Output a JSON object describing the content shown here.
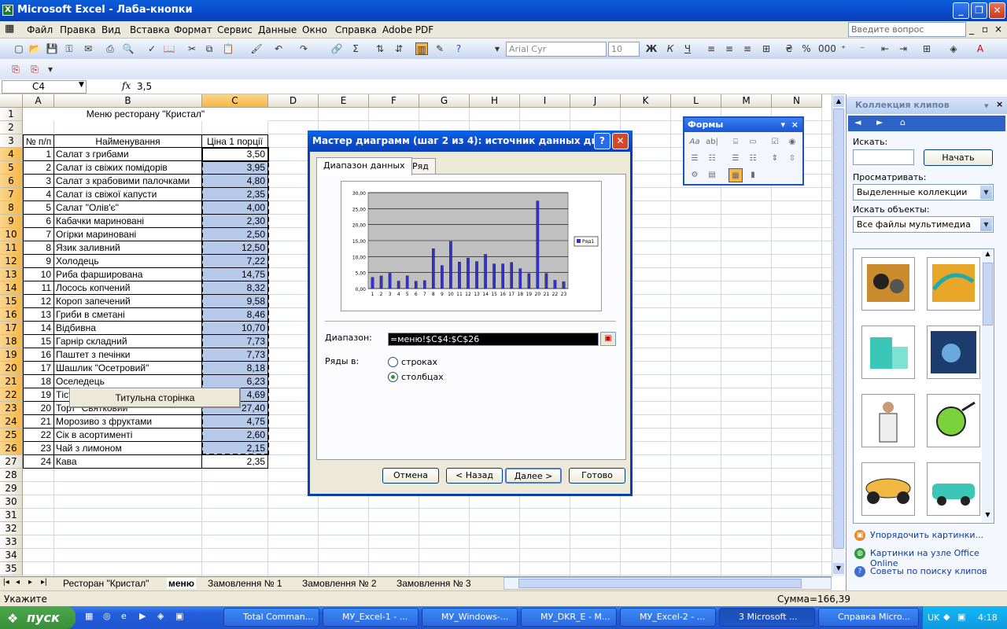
{
  "app": {
    "title": "Microsoft Excel - Лаба-кнопки",
    "logo_glyph": "X"
  },
  "menu": [
    {
      "label": "Файл"
    },
    {
      "label": "Правка"
    },
    {
      "label": "Вид"
    },
    {
      "label": "Вставка"
    },
    {
      "label": "Формат"
    },
    {
      "label": "Сервис"
    },
    {
      "label": "Данные"
    },
    {
      "label": "Окно"
    },
    {
      "label": "Справка"
    },
    {
      "label": "Adobe PDF"
    }
  ],
  "ask": {
    "placeholder": "Введите вопрос"
  },
  "font": {
    "name": "Arial Cyr",
    "size": "10"
  },
  "formula": {
    "cell": "C4",
    "fx": "fx",
    "value": "3,5"
  },
  "columns": [
    "A",
    "B",
    "C",
    "D",
    "E",
    "F",
    "G",
    "H",
    "I",
    "J",
    "K",
    "L",
    "M",
    "N"
  ],
  "rows": [
    "1",
    "2",
    "3",
    "4",
    "5",
    "6",
    "7",
    "8",
    "9",
    "10",
    "11",
    "12",
    "13",
    "14",
    "15",
    "16",
    "17",
    "18",
    "19",
    "20",
    "21",
    "22",
    "23",
    "24",
    "25",
    "26",
    "27",
    "28",
    "29",
    "30",
    "31",
    "32",
    "33",
    "34",
    "35"
  ],
  "sheet": {
    "title": "Меню ресторану \"Кристал\"",
    "headers": [
      "№ п/п",
      "Найменування",
      "Ціна 1 порції"
    ],
    "items": [
      [
        "1",
        "Салат з грибами",
        "3,50"
      ],
      [
        "2",
        "Салат із свіжих помідорів",
        "3,95"
      ],
      [
        "3",
        "Салат з крабовими палочками",
        "4,80"
      ],
      [
        "4",
        "Салат із свіжої капусти",
        "2,35"
      ],
      [
        "5",
        "Салат \"Олів'є\"",
        "4,00"
      ],
      [
        "6",
        "Кабачки мариновані",
        "2,30"
      ],
      [
        "7",
        "Огірки мариновані",
        "2,50"
      ],
      [
        "8",
        "Язик заливний",
        "12,50"
      ],
      [
        "9",
        "Холодець",
        "7,22"
      ],
      [
        "10",
        "Риба фарширована",
        "14,75"
      ],
      [
        "11",
        "Лосось копчений",
        "8,32"
      ],
      [
        "12",
        "Короп запечений",
        "9,58"
      ],
      [
        "13",
        "Гриби в сметані",
        "8,46"
      ],
      [
        "14",
        "Відбивна",
        "10,70"
      ],
      [
        "15",
        "Гарнір складний",
        "7,73"
      ],
      [
        "16",
        "Паштет з печінки",
        "7,73"
      ],
      [
        "17",
        "Шашлик \"Осетровий\"",
        "8,18"
      ],
      [
        "18",
        "Оселедець",
        "6,23"
      ],
      [
        "19",
        "Тістечко \"Наполіон\"",
        "4,69"
      ],
      [
        "20",
        "Торт \"Святковий\"",
        "27,40"
      ],
      [
        "21",
        "Морозиво з фруктами",
        "4,75"
      ],
      [
        "22",
        "Сік в асортименті",
        "2,60"
      ],
      [
        "23",
        "Чай з лимоном",
        "2,15"
      ],
      [
        "24",
        "Кава",
        "2,35"
      ]
    ],
    "button": "Титульна сторінка"
  },
  "tabs": [
    {
      "label": "Ресторан \"Кристал\""
    },
    {
      "label": "меню"
    },
    {
      "label": "Замовлення № 1"
    },
    {
      "label": "Замовлення № 2"
    },
    {
      "label": "Замовлення № 3"
    }
  ],
  "status": {
    "left": "Укажите",
    "sum": "Сумма=166,39"
  },
  "forms_toolbar": {
    "title": "Формы"
  },
  "dialog": {
    "title": "Мастер диаграмм (шаг 2 из 4): источник данных диа...",
    "tab1": "Диапазон данных",
    "tab2": "Ряд",
    "range_label": "Диапазон:",
    "range_value": "=меню!$C$4:$C$26",
    "series_label": "Ряды в:",
    "opt_rows": "строках",
    "opt_cols": "столбцах",
    "btn_cancel": "Отмена",
    "btn_back": "< Назад",
    "btn_next": "Далее >",
    "btn_finish": "Готово"
  },
  "chart_data": {
    "type": "bar",
    "categories": [
      "1",
      "2",
      "3",
      "4",
      "5",
      "6",
      "7",
      "8",
      "9",
      "10",
      "11",
      "12",
      "13",
      "14",
      "15",
      "16",
      "17",
      "18",
      "19",
      "20",
      "21",
      "22",
      "23"
    ],
    "series": [
      {
        "name": "Ряд1",
        "values": [
          3.5,
          3.95,
          4.8,
          2.35,
          4.0,
          2.3,
          2.5,
          12.5,
          7.22,
          14.75,
          8.32,
          9.58,
          8.46,
          10.7,
          7.73,
          7.73,
          8.18,
          6.23,
          4.69,
          27.4,
          4.75,
          2.6,
          2.15
        ]
      }
    ],
    "yticks": [
      "0,00",
      "5,00",
      "10,00",
      "15,00",
      "20,00",
      "25,00",
      "30,00"
    ],
    "ylim": [
      0,
      30
    ],
    "legend": "right",
    "grid": true,
    "bar_color": "#3333cc",
    "plot_bg": "#c0c0c0"
  },
  "taskpane": {
    "title": "Коллекция клипов",
    "search_label": "Искать:",
    "search_btn": "Начать",
    "browse_label": "Просматривать:",
    "browse_value": "Выделенные коллекции",
    "objects_label": "Искать объекты:",
    "objects_value": "Все файлы мультимедиа",
    "links": [
      "Упорядочить картинки...",
      "Картинки на узле Office Online",
      "Советы по поиску клипов"
    ]
  },
  "taskbar": {
    "start": "пуск",
    "items": [
      "Total Comman...",
      "МУ_Excel-1 - ...",
      "МУ_Windows-...",
      "МУ_DKR_E - M...",
      "МУ_Excel-2 - ...",
      "3 Microsoft ...",
      "Справка Micro..."
    ],
    "lang": "UK",
    "time": "4:18"
  }
}
